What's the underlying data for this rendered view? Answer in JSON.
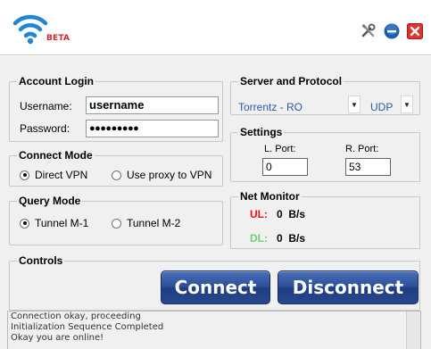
{
  "header": {
    "beta": "BETA",
    "icons": [
      "wifi-logo-icon",
      "tools-icon",
      "minimize-icon",
      "close-icon"
    ],
    "colors": {
      "logo": "#1f86d6",
      "beta": "#d8262a",
      "close": "#e0322d",
      "minimize": "#1b5ea9"
    }
  },
  "account": {
    "title": "Account Login",
    "username_label": "Username:",
    "username_value": "username",
    "password_label": "Password:",
    "password_value": "●●●●●●●●●"
  },
  "connect_mode": {
    "title": "Connect Mode",
    "options": [
      "Direct VPN",
      "Use proxy to VPN"
    ],
    "selected": "Direct VPN"
  },
  "query_mode": {
    "title": "Query Mode",
    "options": [
      "Tunnel M-1",
      "Tunnel M-2"
    ],
    "selected": "Tunnel M-1"
  },
  "server": {
    "title": "Server and Protocol",
    "server_value": "Torrentz - RO",
    "protocol_value": "UDP"
  },
  "settings": {
    "title": "Settings",
    "lport_label": "L. Port:",
    "lport_value": "0",
    "rport_label": "R. Port:",
    "rport_value": "53"
  },
  "net_monitor": {
    "title": "Net Monitor",
    "ul_label": "UL:",
    "ul_value": "0  B/s",
    "dl_label": "DL:",
    "dl_value": "0  B/s",
    "colors": {
      "ul": "#e81212",
      "dl": "#6fd06f"
    }
  },
  "controls": {
    "title": "Controls",
    "connect_label": "Connect",
    "disconnect_label": "Disconnect"
  },
  "log": {
    "lines": [
      "Connection okay, proceeding",
      "Initialization Sequence Completed",
      "Okay you are online!"
    ]
  }
}
